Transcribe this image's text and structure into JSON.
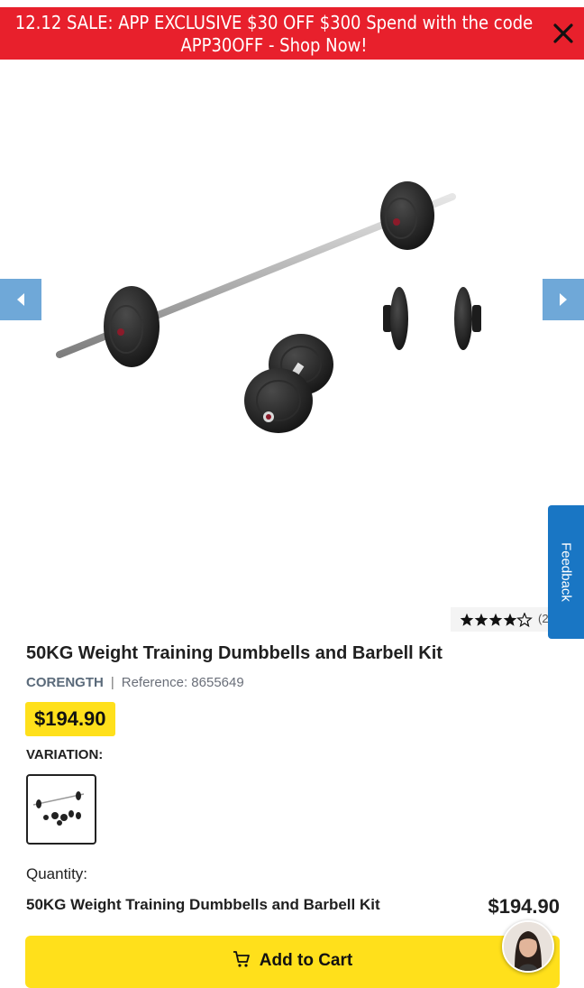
{
  "promo_banner": {
    "line1": "12.12 SALE: APP EXCLUSIVE $30 OFF $300 Spend with the code",
    "line2": "APP30OFF - Shop Now!",
    "color": "#e8202c"
  },
  "gallery": {
    "prev_icon": "chevron-left-icon",
    "next_icon": "chevron-right-icon",
    "image": "barbell-and-dumbbells-product-image"
  },
  "feedback_tab": {
    "label": "Feedback",
    "color": "#1976c4"
  },
  "rating": {
    "stars": 4.5,
    "count_text": "(2"
  },
  "product": {
    "title": "50KG Weight Training Dumbbells and Barbell Kit",
    "brand": "CORENGTH",
    "separator": "|",
    "reference": "Reference: 8655649",
    "price": "$194.90"
  },
  "variation": {
    "label": "VARIATION:"
  },
  "quantity": {
    "label": "Quantity:"
  },
  "summary": {
    "name": "50KG Weight Training Dumbbells and Barbell Kit",
    "price": "$194.90"
  },
  "cart_button": {
    "label": "Add to Cart",
    "icon": "cart-icon",
    "color": "#ffe01b"
  },
  "chat": {
    "icon": "support-agent-avatar"
  }
}
